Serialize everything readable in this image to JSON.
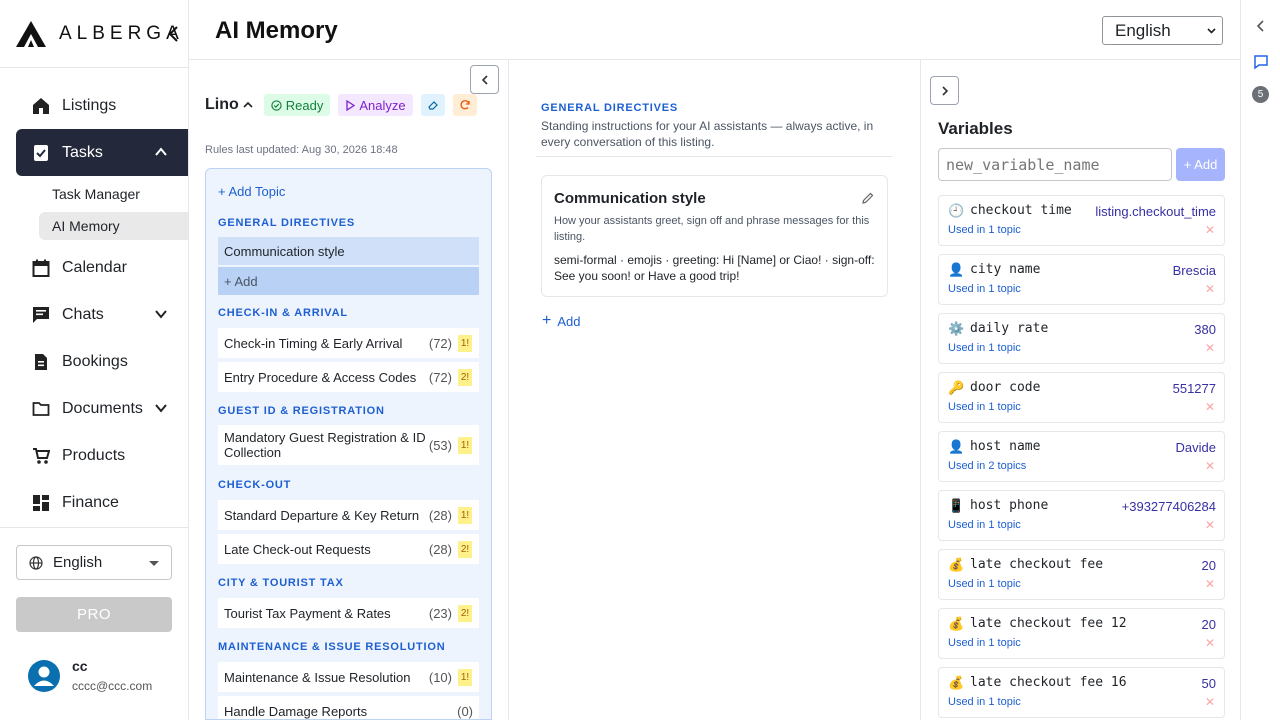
{
  "app": {
    "brand": "ALBERGA",
    "colors": {
      "active_nav": "#23293a",
      "accent": "#1d5fd1",
      "ready": "#15803d",
      "analyze": "#7e22ce"
    }
  },
  "sidebar": {
    "items": [
      {
        "label": "Listings",
        "icon": "home-icon"
      },
      {
        "label": "Tasks",
        "icon": "clipboard-icon"
      },
      {
        "label": "Calendar",
        "icon": "calendar-icon"
      },
      {
        "label": "Chats",
        "icon": "chat-icon"
      },
      {
        "label": "Bookings",
        "icon": "document-icon"
      },
      {
        "label": "Documents",
        "icon": "folder-icon"
      },
      {
        "label": "Products",
        "icon": "cart-icon"
      },
      {
        "label": "Finance",
        "icon": "grid-icon"
      }
    ],
    "sub_items": [
      "Task Manager",
      "AI Memory"
    ],
    "language": "English",
    "pro_label": "PRO",
    "user": {
      "name": "cc",
      "email": "cccc@ccc.com"
    }
  },
  "header": {
    "title": "AI Memory",
    "language": "English"
  },
  "rail": {
    "badge": "5"
  },
  "topics": {
    "listing_name": "Lino",
    "ready_label": "Ready",
    "analyze_label": "Analyze",
    "rules_updated": "Rules last updated: Aug 30, 2026 18:48",
    "add_topic": "+ Add Topic",
    "sections": [
      "GENERAL DIRECTIVES",
      "CHECK-IN & ARRIVAL",
      "GUEST ID & REGISTRATION",
      "CHECK-OUT",
      "CITY & TOURIST TAX",
      "MAINTENANCE & ISSUE RESOLUTION"
    ],
    "general": {
      "selected": "Communication style",
      "add": "+ Add"
    },
    "items": [
      {
        "name": "Check-in Timing & Early Arrival",
        "count": "(72)",
        "flag": "1!"
      },
      {
        "name": "Entry Procedure & Access Codes",
        "count": "(72)",
        "flag": "2!"
      },
      {
        "name": "Mandatory Guest Registration & ID Collection",
        "count": "(53)",
        "flag": "1!"
      },
      {
        "name": "Standard Departure & Key Return",
        "count": "(28)",
        "flag": "1!"
      },
      {
        "name": "Late Check-out Requests",
        "count": "(28)",
        "flag": "2!"
      },
      {
        "name": "Tourist Tax Payment & Rates",
        "count": "(23)",
        "flag": "2!"
      },
      {
        "name": "Maintenance & Issue Resolution",
        "count": "(10)",
        "flag": "1!"
      },
      {
        "name": "Handle Damage Reports",
        "count": "(0)",
        "flag": ""
      }
    ]
  },
  "directives": {
    "title": "GENERAL DIRECTIVES",
    "description": "Standing instructions for your AI assistants — always active, in every conversation of this listing.",
    "card": {
      "title": "Communication style",
      "description": "How your assistants greet, sign off and phrase messages for this listing.",
      "text": "semi-formal · emojis · greeting: Hi [Name] or Ciao! · sign-off: See you soon! or Have a good trip!"
    },
    "add_label": "Add"
  },
  "variables": {
    "title": "Variables",
    "placeholder": "new_variable_name",
    "add_label": "+ Add",
    "delete_glyph": "✕",
    "items": [
      {
        "icon": "🕘",
        "name": "checkout time",
        "value": "listing.checkout_time",
        "used": "Used in 1 topic"
      },
      {
        "icon": "👤",
        "name": "city name",
        "value": "Brescia",
        "used": "Used in 1 topic"
      },
      {
        "icon": "⚙️",
        "name": "daily rate",
        "value": "380",
        "used": "Used in 1 topic"
      },
      {
        "icon": "🔑",
        "name": "door code",
        "value": "551277",
        "used": "Used in 1 topic"
      },
      {
        "icon": "👤",
        "name": "host name",
        "value": "Davide",
        "used": "Used in 2 topics"
      },
      {
        "icon": "📱",
        "name": "host phone",
        "value": "+393277406284",
        "used": "Used in 1 topic"
      },
      {
        "icon": "💰",
        "name": "late checkout fee",
        "value": "20",
        "used": "Used in 1 topic"
      },
      {
        "icon": "💰",
        "name": "late checkout fee 12",
        "value": "20",
        "used": "Used in 1 topic"
      },
      {
        "icon": "💰",
        "name": "late checkout fee 16",
        "value": "50",
        "used": "Used in 1 topic"
      }
    ]
  }
}
